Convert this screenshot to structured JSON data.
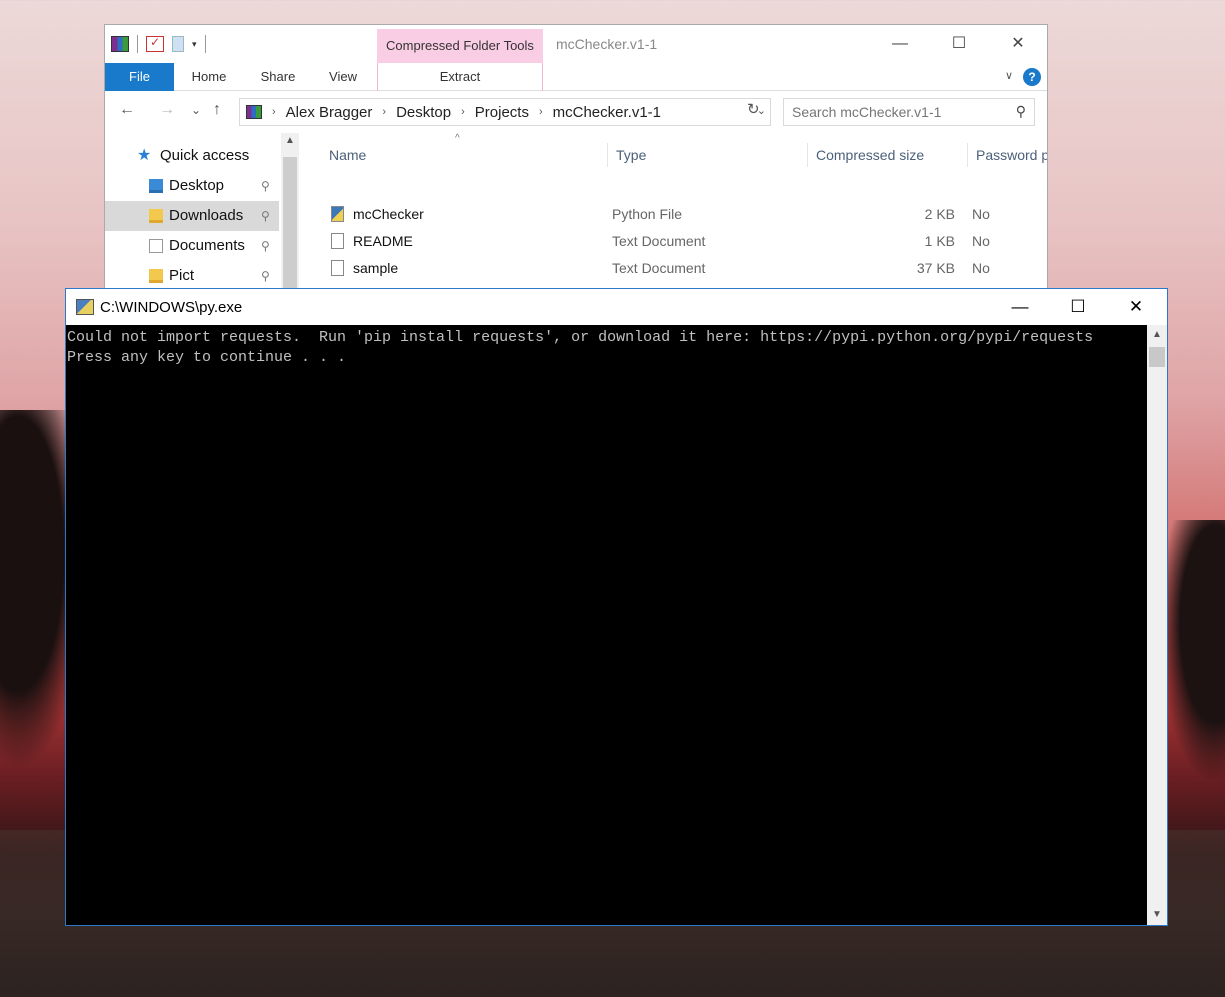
{
  "explorer": {
    "qat_dropdown": "▾",
    "context_tab_group": "Compressed Folder Tools",
    "window_title": "mcChecker.v1-1",
    "controls": {
      "minimize": "—",
      "maximize": "☐",
      "close": "✕"
    },
    "tabs": {
      "file": "File",
      "home": "Home",
      "share": "Share",
      "view": "View",
      "extract": "Extract"
    },
    "ribbon_expand": "∨",
    "help": "?",
    "nav": {
      "back": "←",
      "forward": "→",
      "recent": "⌄",
      "up": "↑",
      "refresh": "↻"
    },
    "breadcrumb": [
      "Alex Bragger",
      "Desktop",
      "Projects",
      "mcChecker.v1-1"
    ],
    "crumb_separator": "›",
    "address_dropdown": "⌄",
    "search": {
      "placeholder": "Search mcChecker.v1-1"
    },
    "navpane": {
      "quick_access": "Quick access",
      "items": [
        {
          "label": "Desktop",
          "pinned": true
        },
        {
          "label": "Downloads",
          "pinned": true,
          "selected": true
        },
        {
          "label": "Documents",
          "pinned": true
        },
        {
          "label": "Pict",
          "pinned": true
        }
      ],
      "pin_glyph": "⚲"
    },
    "columns": {
      "name": "Name",
      "type": "Type",
      "compressed_size": "Compressed size",
      "password": "Password p..."
    },
    "sort_caret": "^",
    "files": [
      {
        "name": "mcChecker",
        "type": "Python File",
        "size": "2 KB",
        "password": "No",
        "icon": "python-file-icon"
      },
      {
        "name": "README",
        "type": "Text Document",
        "size": "1 KB",
        "password": "No",
        "icon": "text-file-icon"
      },
      {
        "name": "sample",
        "type": "Text Document",
        "size": "37 KB",
        "password": "No",
        "icon": "text-file-icon"
      }
    ]
  },
  "console": {
    "title": "C:\\WINDOWS\\py.exe",
    "controls": {
      "minimize": "—",
      "maximize": "☐",
      "close": "✕"
    },
    "lines": [
      "Could not import requests.  Run 'pip install requests', or download it here: https://pypi.python.org/pypi/requests",
      "Press any key to continue . . ."
    ],
    "scroll_up": "▲",
    "scroll_down": "▼"
  },
  "colors": {
    "accent": "#1979ca",
    "context_tab": "#f9cde4",
    "console_bg": "#000000",
    "console_text": "#c0c0c0"
  }
}
